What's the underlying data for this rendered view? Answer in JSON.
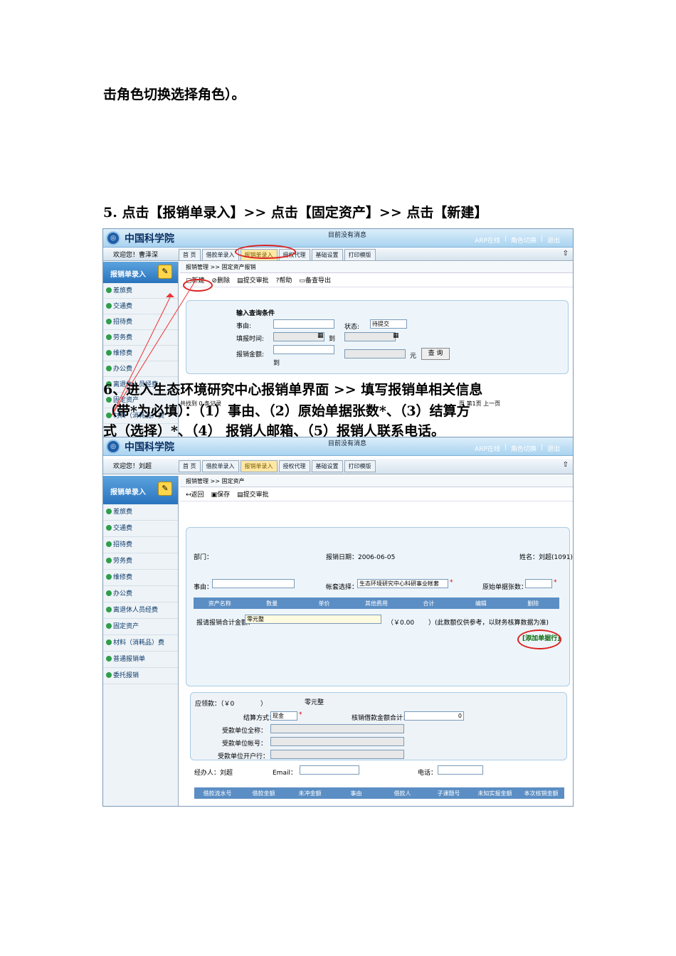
{
  "doc": {
    "line1": "击角色切换选择角色）。",
    "step5": "5. 点击【报销单录入】>> 点击【固定资产】>> 点击【新建】",
    "step6_line1": "6、进入生态环境研究中心报销单界面 >> 填写报销单相关信息",
    "step6_line2": "（带*为必填）：（1）事由、（2）原始单据张数*、（3）结算方",
    "step6_line3": "式（选择）*、（4） 报销人邮箱、（5）报销人联系电话。"
  },
  "shot1": {
    "logo": "中国科学院",
    "message": "目前没有消息",
    "links": [
      "ARP在线",
      "|",
      "角色切换",
      "|",
      "退出"
    ],
    "welcome": "欢迎您！曹泽深",
    "tabs": [
      "首 页",
      "借款单录入",
      "报销单录入",
      "授权代理",
      "基础设置",
      "打印模版"
    ],
    "active_tab": 2,
    "side_title": "报销单录入",
    "side_items": [
      "差旅费",
      "交通费",
      "招待费",
      "劳务费",
      "维修费",
      "办公费",
      "离退休人员经费",
      "固定资产",
      "材料（消耗品）费"
    ],
    "breadcrumb": "报销管理 >> 固定资产报销",
    "toolbar": [
      "新建",
      "删除",
      "提交审批",
      "帮助",
      "备查导出"
    ],
    "query_title": "输入查询条件",
    "field_reason": "事由:",
    "field_status": "状态:",
    "status_value": "待提交",
    "field_date": "填报时间:",
    "to1": "到",
    "field_amount": "报销金额:",
    "to2": "到",
    "yuan": "元",
    "query_btn": "查 询",
    "footer": "共找到 0 条记录",
    "footer_right": "页 第1页 上一页"
  },
  "shot2": {
    "logo": "中国科学院",
    "message": "目前没有消息",
    "links": [
      "ARP在线",
      "|",
      "角色切换",
      "|",
      "退出"
    ],
    "welcome": "欢迎您！刘超",
    "tabs": [
      "首 页",
      "借款单录入",
      "报销单录入",
      "授权代理",
      "基础设置",
      "打印模版"
    ],
    "active_tab": 2,
    "side_title": "报销单录入",
    "side_items": [
      "差旅费",
      "交通费",
      "招待费",
      "劳务费",
      "维修费",
      "办公费",
      "离退休人员经费",
      "固定资产",
      "材料（消耗品）费",
      "普通报销单",
      "委托报销"
    ],
    "breadcrumb": "报销管理 >> 固定资产",
    "toolbar": [
      "返回",
      "保存",
      "提交审批"
    ],
    "dept": "部门：",
    "date": "报销日期：2006-06-05",
    "name": "姓名：刘超(1091)",
    "reason": "事由：",
    "ledger_label": "帐套选择：",
    "ledger_value": "生态环境研究中心科研事业帐套",
    "orig_count": "原始单据张数：",
    "cols": [
      "资产名称",
      "数量",
      "单价",
      "其他费用",
      "合计",
      "编辑",
      "删除"
    ],
    "total_label": "报请报销合计金额：",
    "total_value": "零元整",
    "total_num": "（￥0.00",
    "total_note": "）(此数额仅供参考，以财务核算数据为准)",
    "add_row": "[添加单据行]",
    "payable_label": "应领款：（￥0",
    "payable_close": "）",
    "payable_words": "零元整",
    "settle_label": "结算方式：",
    "settle_value": "现金",
    "loan_label": "核销借款金额合计：",
    "loan_value": "0",
    "payee_name": "受款单位全称：",
    "payee_acct": "受款单位帐号：",
    "payee_bank": "受款单位开户行：",
    "handler": "经办人：刘超",
    "email": "Email：",
    "phone": "电话：",
    "loan_cols": [
      "借款流水号",
      "借款金额",
      "未冲金额",
      "事由",
      "借款人",
      "子课题号",
      "未知实报金额",
      "本次核销金额"
    ]
  }
}
